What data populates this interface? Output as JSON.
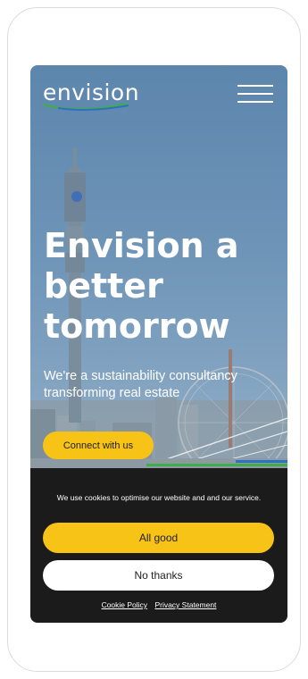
{
  "header": {
    "logo_text": "envision",
    "menu_icon": "hamburger-icon",
    "brand_colors": {
      "swoosh_green": "#3fae49",
      "swoosh_blue": "#2f6fc4"
    }
  },
  "hero": {
    "title_lines": [
      "Envision a",
      "better",
      "tomorrow"
    ],
    "subtitle": "We're a sustainability consultancy transforming real estate",
    "cta_label": "Connect with us"
  },
  "cookie_banner": {
    "message": "We use cookies to optimise our website and and our service.",
    "accept_label": "All good",
    "decline_label": "No thanks",
    "links": [
      "Cookie Policy",
      "Privacy Statement"
    ]
  },
  "colors": {
    "accent": "#f7c316",
    "banner_bg": "#1b1b1b",
    "hero_sky": "#6f95b8"
  }
}
